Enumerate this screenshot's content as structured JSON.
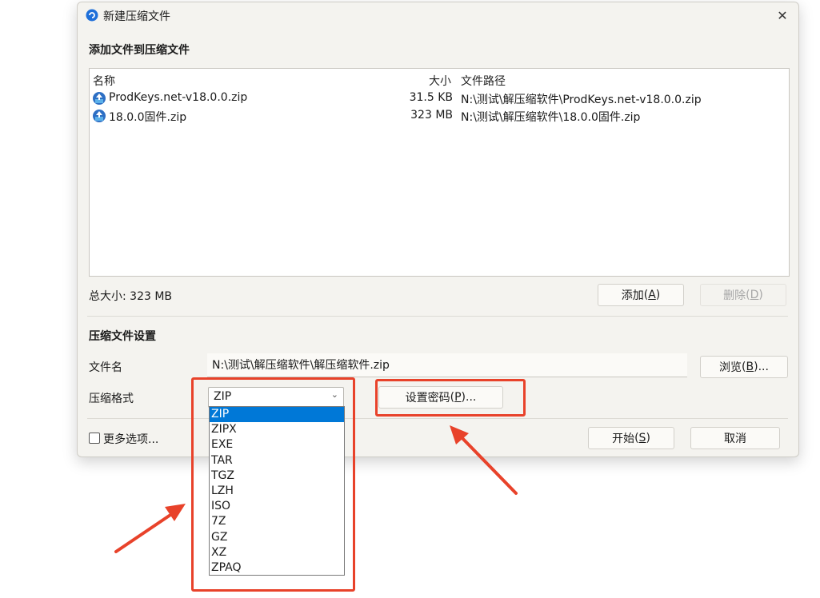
{
  "window": {
    "title": "新建压缩文件",
    "close_glyph": "✕"
  },
  "add_section": {
    "heading": "添加文件到压缩文件"
  },
  "file_list": {
    "columns": {
      "name": "名称",
      "size": "大小",
      "path": "文件路径"
    },
    "rows": [
      {
        "name": "ProdKeys.net-v18.0.0.zip",
        "size": "31.5 KB",
        "path": "N:\\测试\\解压缩软件\\ProdKeys.net-v18.0.0.zip"
      },
      {
        "name": "18.0.0固件.zip",
        "size": "323 MB",
        "path": "N:\\测试\\解压缩软件\\18.0.0固件.zip"
      }
    ]
  },
  "total_size": "总大小: 323 MB",
  "buttons": {
    "add": {
      "label": "添加",
      "key": "A"
    },
    "delete": {
      "label": "删除",
      "key": "D"
    },
    "browse": {
      "label": "浏览",
      "key": "B",
      "suffix": "..."
    },
    "set_password": {
      "label": "设置密码",
      "key": "P",
      "suffix": "..."
    },
    "start": {
      "label": "开始",
      "key": "S"
    },
    "cancel": "取消"
  },
  "settings_section": {
    "heading": "压缩文件设置",
    "filename_label": "文件名",
    "filename_value": "N:\\测试\\解压缩软件\\解压缩软件.zip",
    "format_label": "压缩格式",
    "format_value": "ZIP",
    "format_options": [
      "ZIP",
      "ZIPX",
      "EXE",
      "TAR",
      "TGZ",
      "LZH",
      "ISO",
      "7Z",
      "GZ",
      "XZ",
      "ZPAQ"
    ]
  },
  "more_options": "更多选项...",
  "colors": {
    "accent": "#0078d7",
    "highlight": "#e8422a",
    "dialog_bg": "#f4f3ef"
  },
  "icons": {
    "app": "app-logo-icon",
    "file": "archive-file-icon",
    "dropdown": "chevron-down-icon"
  }
}
